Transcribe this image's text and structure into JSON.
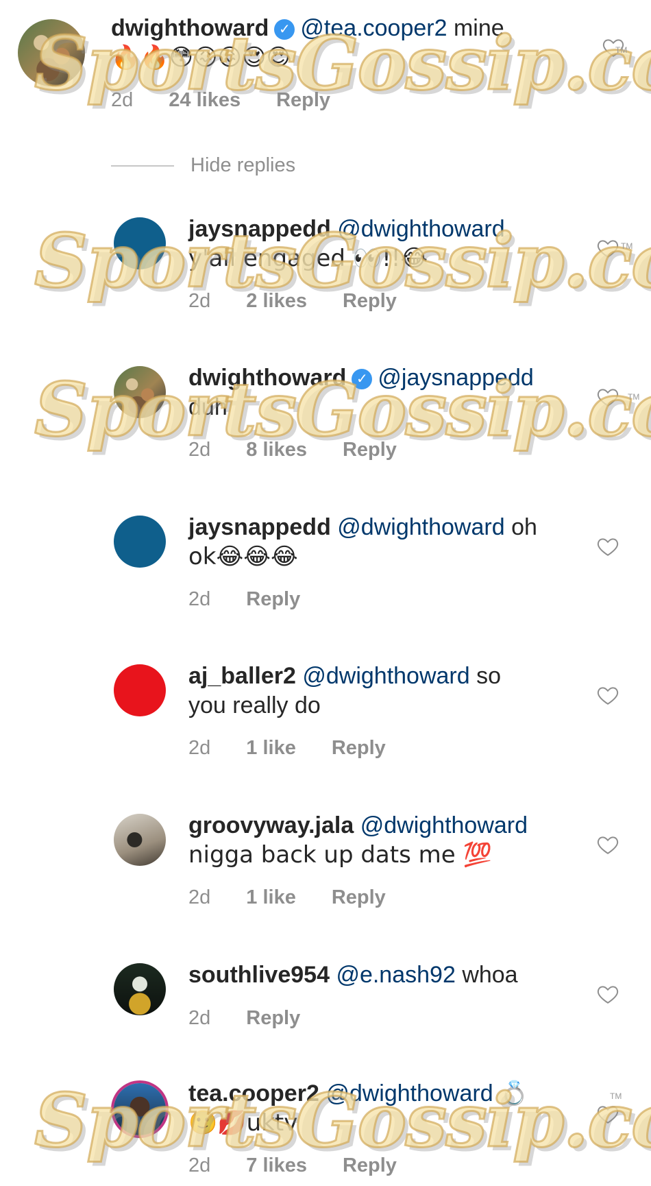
{
  "watermark": {
    "text": "SportsGossip.com",
    "tm": "TM"
  },
  "hide_replies_label": "Hide replies",
  "comments": [
    {
      "username": "dwighthoward",
      "verified": true,
      "mention": "@tea.cooper2",
      "text": "mine",
      "line2": "🔥🔥😳😖😖😍😍",
      "time": "2d",
      "likes": "24 likes",
      "reply": "Reply"
    },
    {
      "username": "jaysnappedd",
      "verified": false,
      "mention": "@dwighthoward",
      "text": "",
      "line2": "y'all engaged 👀!!😂",
      "time": "2d",
      "likes": "2 likes",
      "reply": "Reply"
    },
    {
      "username": "dwighthoward",
      "verified": true,
      "mention": "@jaysnappedd",
      "text": "",
      "line2": "duh",
      "time": "2d",
      "likes": "8 likes",
      "reply": "Reply"
    },
    {
      "username": "jaysnappedd",
      "verified": false,
      "mention": "@dwighthoward",
      "text": "oh",
      "line2": "ok😂😂😂",
      "time": "2d",
      "likes": "",
      "reply": "Reply"
    },
    {
      "username": "aj_baller2",
      "verified": false,
      "mention": "@dwighthoward",
      "text": "so",
      "line2": "you really do",
      "time": "2d",
      "likes": "1 like",
      "reply": "Reply"
    },
    {
      "username": "groovyway.jala",
      "verified": false,
      "mention": "@dwighthoward",
      "text": "",
      "line2": "nigga back up dats me 💯",
      "time": "2d",
      "likes": "1 like",
      "reply": "Reply"
    },
    {
      "username": "southlive954",
      "verified": false,
      "mention": "@e.nash92",
      "text": "whoa",
      "line2": "",
      "time": "2d",
      "likes": "",
      "reply": "Reply"
    },
    {
      "username": "tea.cooper2",
      "verified": false,
      "mention": "@dwighthoward",
      "text": "💍",
      "line2": "🙂💋uktv",
      "time": "2d",
      "likes": "7 likes",
      "reply": "Reply"
    }
  ],
  "colors": {
    "username": "#262626",
    "mention": "#00376b",
    "meta": "#8e8e8e",
    "verified": "#3897f0",
    "avatar_blue": "#0f5f8c",
    "avatar_red": "#e8141c",
    "story_ring": "#c13584"
  },
  "icons": {
    "like": "heart-outline-icon",
    "verified": "verified-badge-icon"
  }
}
